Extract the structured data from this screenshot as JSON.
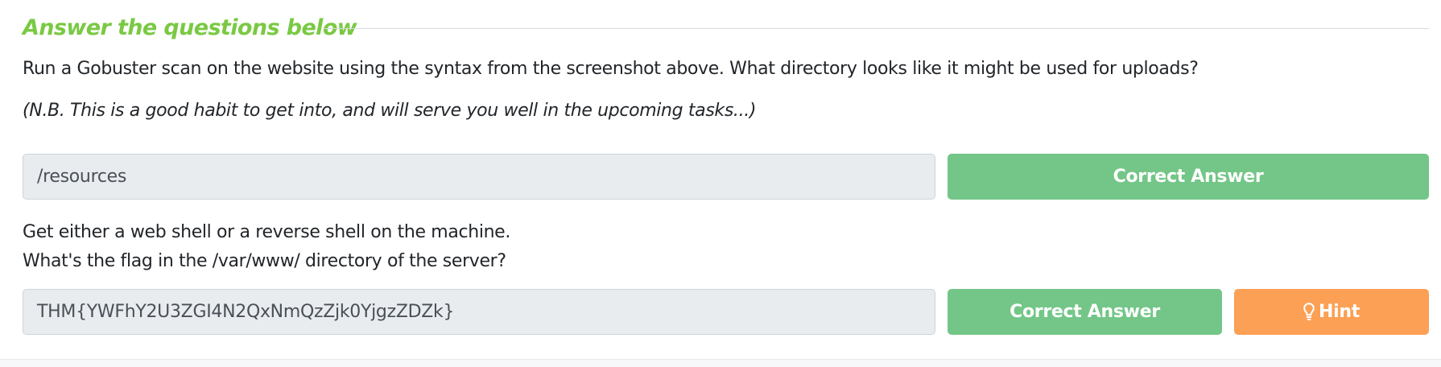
{
  "section": {
    "title": "Answer the questions below"
  },
  "questions": [
    {
      "lines": [
        "Run a Gobuster scan on the website using the syntax from the screenshot above. What directory looks like it might be used for uploads?"
      ],
      "note": "(N.B. This is a good habit to get into, and will serve you well in the upcoming tasks...)",
      "answer_value": "/resources",
      "submit_label": "Correct Answer"
    },
    {
      "lines": [
        "Get either a web shell or a reverse shell on the machine.",
        "What's the flag in the /var/www/ directory of the server?"
      ],
      "answer_value": "THM{YWFhY2U3ZGI4N2QxNmQzZjk0YjgzZDZk}",
      "submit_label": "Correct Answer",
      "hint_label": "Hint"
    }
  ],
  "icons": {
    "hint": "lightbulb-icon"
  },
  "colors": {
    "section_title": "#7ac943",
    "correct_button": "#73c687",
    "hint_button": "#fba055",
    "answer_field_bg": "#e9ecef"
  }
}
